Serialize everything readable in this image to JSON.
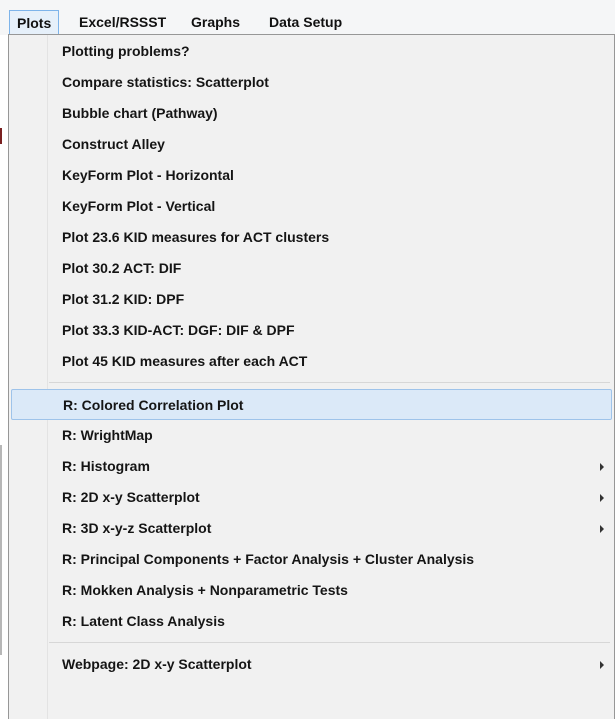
{
  "menubar": {
    "items": [
      "Plots",
      "Excel/RSSST",
      "Graphs",
      "Data Setup"
    ],
    "active_index": 0
  },
  "plots_menu": {
    "groups": [
      {
        "items": [
          {
            "label": "Plotting problems?"
          },
          {
            "label": "Compare statistics: Scatterplot"
          },
          {
            "label": "Bubble chart (Pathway)"
          },
          {
            "label": "Construct Alley"
          },
          {
            "label": "KeyForm Plot - Horizontal"
          },
          {
            "label": "KeyForm Plot - Vertical"
          },
          {
            "label": "Plot 23.6 KID measures for ACT clusters"
          },
          {
            "label": "Plot 30.2 ACT: DIF"
          },
          {
            "label": "Plot 31.2 KID: DPF"
          },
          {
            "label": "Plot 33.3 KID-ACT: DGF: DIF & DPF"
          },
          {
            "label": "Plot 45 KID measures after each ACT"
          }
        ]
      },
      {
        "items": [
          {
            "label": "R: Colored Correlation Plot",
            "highlighted": true
          },
          {
            "label": "R: WrightMap"
          },
          {
            "label": "R: Histogram",
            "has_submenu": true
          },
          {
            "label": "R: 2D x-y Scatterplot",
            "has_submenu": true
          },
          {
            "label": "R: 3D x-y-z Scatterplot",
            "has_submenu": true
          },
          {
            "label": "R: Principal Components + Factor Analysis + Cluster Analysis"
          },
          {
            "label": "R: Mokken Analysis + Nonparametric Tests"
          },
          {
            "label": "R: Latent Class Analysis"
          }
        ]
      },
      {
        "items": [
          {
            "label": "Webpage: 2D x-y Scatterplot",
            "has_submenu": true
          }
        ]
      }
    ]
  }
}
